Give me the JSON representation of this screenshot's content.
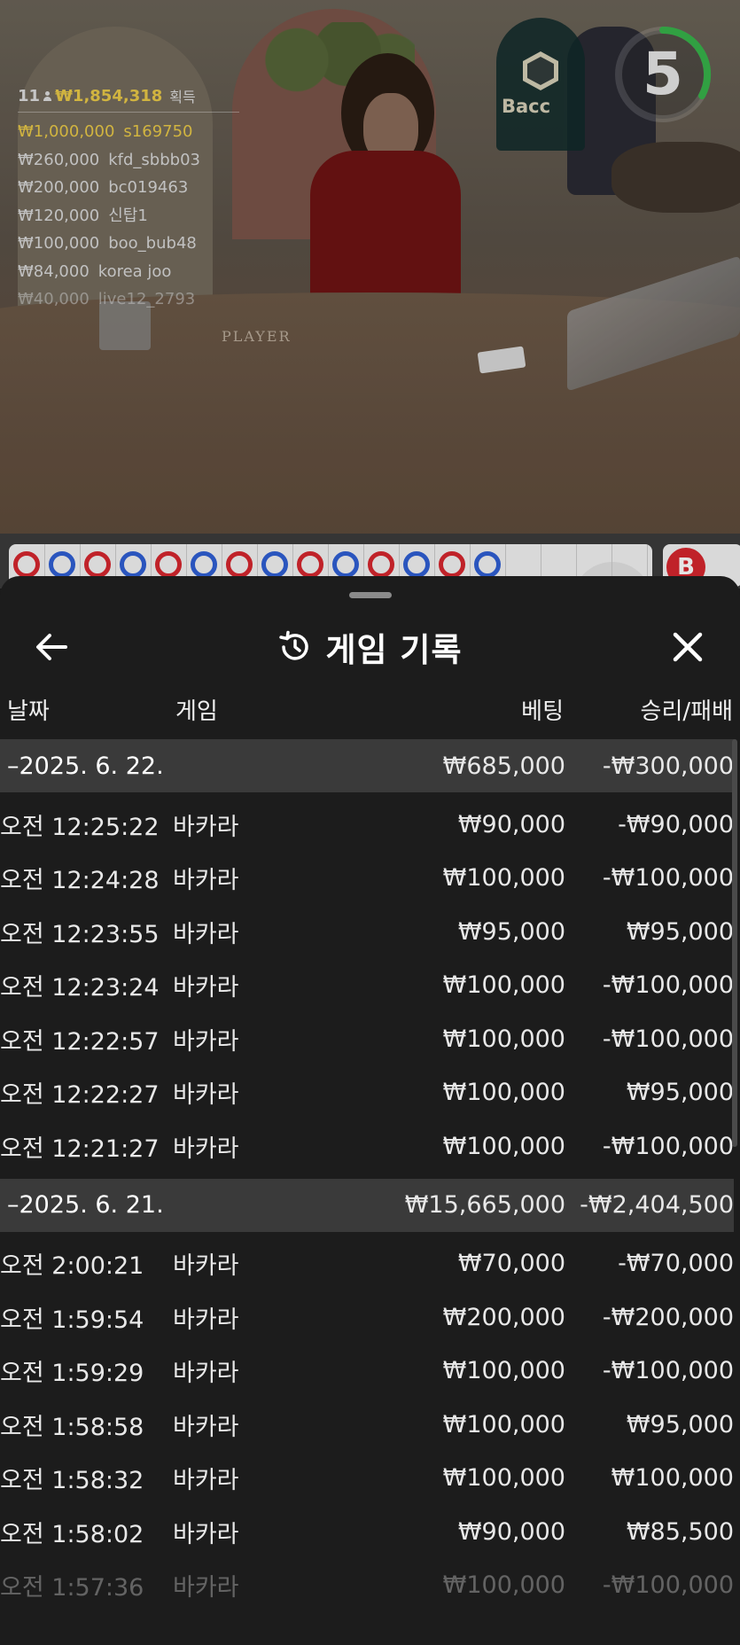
{
  "video": {
    "table_label": "PLAYER",
    "badge_label": "Bacc",
    "timer_value": "5",
    "leaderboard": {
      "count": "11",
      "total": "₩1,854,318",
      "won_label": "획득",
      "rows": [
        {
          "amount": "₩1,000,000",
          "name": "s169750"
        },
        {
          "amount": "₩260,000",
          "name": "kfd_sbbb03"
        },
        {
          "amount": "₩200,000",
          "name": "bc019463"
        },
        {
          "amount": "₩120,000",
          "name": "신탑1"
        },
        {
          "amount": "₩100,000",
          "name": "boo_bub48"
        },
        {
          "amount": "₩84,000",
          "name": "korea joo"
        },
        {
          "amount": "₩40,000",
          "name": "live12_2793"
        }
      ]
    },
    "road_button": "B",
    "beads": [
      "r",
      "b",
      "r",
      "b",
      "r",
      "b",
      "r",
      "b",
      "r",
      "b",
      "r",
      "b",
      "r",
      "b"
    ]
  },
  "colors": {
    "player_blue": "#2f5fd4",
    "banker_red": "#d6262e",
    "gold": "#e9c948"
  },
  "sheet": {
    "title": "게임 기록",
    "icons": {
      "back": "arrow-left-icon",
      "history": "history-icon",
      "close": "close-icon"
    },
    "columns": {
      "date": "날짜",
      "game": "게임",
      "bet": "베팅",
      "result": "승리/패배"
    },
    "groups": [
      {
        "date": "–2025. 6. 22.",
        "total_bet": "₩685,000",
        "total_result": "-₩300,000",
        "rows": [
          {
            "time": "오전 12:25:22",
            "game": "바카라",
            "bet": "₩90,000",
            "result": "-₩90,000"
          },
          {
            "time": "오전 12:24:28",
            "game": "바카라",
            "bet": "₩100,000",
            "result": "-₩100,000"
          },
          {
            "time": "오전 12:23:55",
            "game": "바카라",
            "bet": "₩95,000",
            "result": "₩95,000"
          },
          {
            "time": "오전 12:23:24",
            "game": "바카라",
            "bet": "₩100,000",
            "result": "-₩100,000"
          },
          {
            "time": "오전 12:22:57",
            "game": "바카라",
            "bet": "₩100,000",
            "result": "-₩100,000"
          },
          {
            "time": "오전 12:22:27",
            "game": "바카라",
            "bet": "₩100,000",
            "result": "₩95,000"
          },
          {
            "time": "오전 12:21:27",
            "game": "바카라",
            "bet": "₩100,000",
            "result": "-₩100,000"
          }
        ]
      },
      {
        "date": "–2025. 6. 21.",
        "total_bet": "₩15,665,000",
        "total_result": "-₩2,404,500",
        "rows": [
          {
            "time": "오전 2:00:21",
            "game": "바카라",
            "bet": "₩70,000",
            "result": "-₩70,000"
          },
          {
            "time": "오전 1:59:54",
            "game": "바카라",
            "bet": "₩200,000",
            "result": "-₩200,000"
          },
          {
            "time": "오전 1:59:29",
            "game": "바카라",
            "bet": "₩100,000",
            "result": "-₩100,000"
          },
          {
            "time": "오전 1:58:58",
            "game": "바카라",
            "bet": "₩100,000",
            "result": "₩95,000"
          },
          {
            "time": "오전 1:58:32",
            "game": "바카라",
            "bet": "₩100,000",
            "result": "₩100,000"
          },
          {
            "time": "오전 1:58:02",
            "game": "바카라",
            "bet": "₩90,000",
            "result": "₩85,500"
          },
          {
            "time": "오전 1:57:36",
            "game": "바카라",
            "bet": "₩100,000",
            "result": "-₩100,000"
          }
        ]
      }
    ]
  }
}
